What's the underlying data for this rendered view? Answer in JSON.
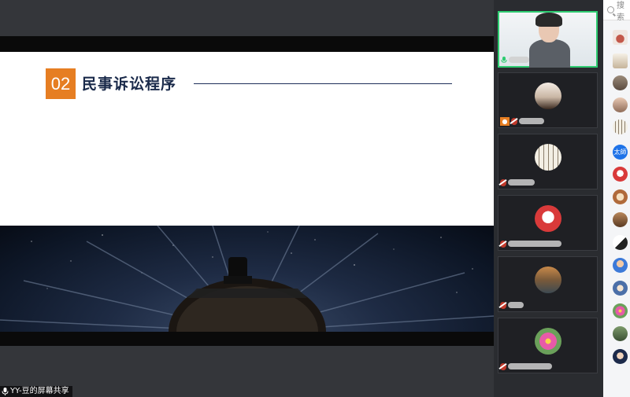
{
  "slide": {
    "number": "02",
    "title": "民事诉讼程序"
  },
  "share_label": "YY-豆的屏幕共享",
  "search": {
    "placeholder": "搜索"
  },
  "user_list": {
    "badge_text": "太師"
  },
  "colors": {
    "accent_orange": "#e67e22",
    "active_green": "#2ecc71",
    "mic_muted": "#c0392b",
    "title_navy": "#1a2a4a"
  }
}
